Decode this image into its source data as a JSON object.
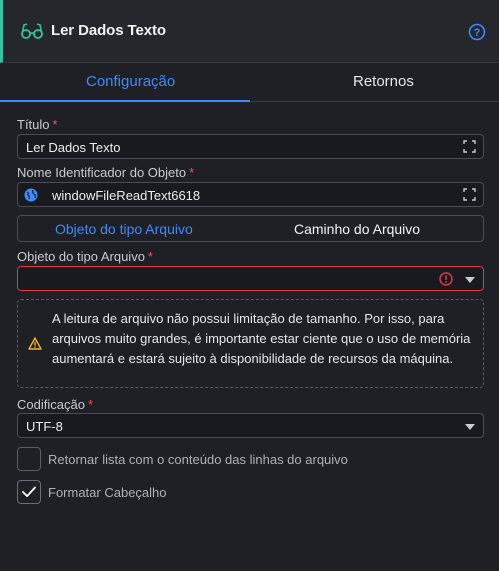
{
  "header": {
    "title": "Ler Dados Texto",
    "icon": "glasses-icon",
    "help_icon": "help-circle-icon",
    "accent": "#2ec4a4"
  },
  "tabs": [
    {
      "label": "Configuração",
      "active": true
    },
    {
      "label": "Retornos",
      "active": false
    }
  ],
  "form": {
    "titulo": {
      "label": "Título",
      "value": "Ler Dados Texto"
    },
    "nome": {
      "label": "Nome Identificador do Objeto",
      "value": "windowFileReadText6618"
    },
    "source_toggle": {
      "options": [
        "Objeto do tipo Arquivo",
        "Caminho do Arquivo"
      ],
      "selected": "Objeto do tipo Arquivo"
    },
    "objeto": {
      "label": "Objeto do tipo Arquivo",
      "value": ""
    },
    "warning": "A leitura de arquivo não possui limitação de tamanho. Por isso, para arquivos muito grandes, é importante estar ciente que o uso de memória aumentará e estará sujeito à disponibilidade de recursos da máquina.",
    "codificacao": {
      "label": "Codificação",
      "value": "UTF-8"
    },
    "checkbox_lines": {
      "label": "Retornar lista com o conteúdo das linhas do arquivo",
      "checked": false
    },
    "checkbox_header": {
      "label": "Formatar Cabeçalho",
      "checked": true
    }
  },
  "colors": {
    "primary": "#3d8bfd",
    "error": "#e0393e",
    "warning": "#f0b429"
  }
}
